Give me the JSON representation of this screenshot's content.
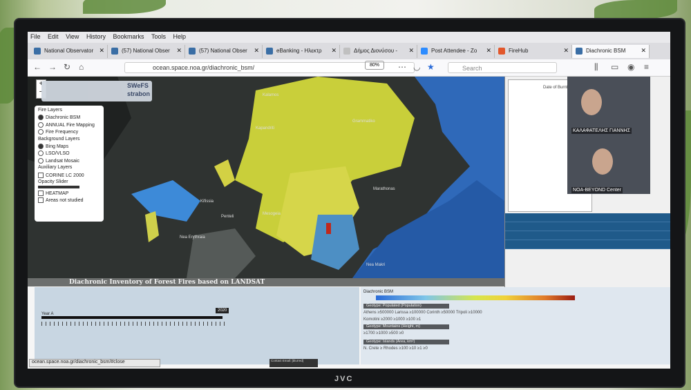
{
  "browser": {
    "menu": [
      "File",
      "Edit",
      "View",
      "History",
      "Bookmarks",
      "Tools",
      "Help"
    ],
    "tabs": [
      {
        "label": "National Observator"
      },
      {
        "label": "(57) National Obser"
      },
      {
        "label": "(57) National Obser"
      },
      {
        "label": "eBanking - Ηλεκτρ"
      },
      {
        "label": "Δήμος Διονύσου -"
      },
      {
        "label": "Post Attendee - Zo"
      },
      {
        "label": "FireHub"
      },
      {
        "label": "Diachronic BSM"
      }
    ],
    "url": "ocean.space.noa.gr/diachronic_bsm/",
    "zoom": "80%",
    "search_placeholder": "Search"
  },
  "map": {
    "logos": [
      "SWeFS",
      "strabon"
    ],
    "layers_panel": {
      "fire_header": "Fire Layers",
      "fire_items": [
        "Diachronic BSM",
        "ANNUAL Fire Mapping",
        "Fire Frequency"
      ],
      "background_header": "Background Layers",
      "background_items": [
        "Bing Maps",
        "LSO/VLSO",
        "Landsat Mosaic"
      ],
      "aux_header": "Auxiliary Layers",
      "aux_items": [
        "CORINE LC 2000",
        "Opacity Slider",
        "HEATMAP",
        "Areas not studied"
      ]
    },
    "places": [
      "Kalamos",
      "Grammatiko",
      "Marathonas",
      "Kapandriti",
      "Nea Makri",
      "Kifissia",
      "Penteli",
      "Mesogeia",
      "Nea Erythraia"
    ]
  },
  "panel": {
    "legend_title": "Date of Burnt Ar",
    "video": {
      "name_1": "ΚΑΛΑΦΑΤΕΛΗΣ ΓΙΑΝΝΗΣ",
      "name_2": "NOA-BEYOND Center"
    }
  },
  "bottom": {
    "title": "Diachronic Inventory of Forest Fires based on LANDSAT",
    "year_label": "Year A",
    "year_value": "2020",
    "bsm_title": "Diachronic BSM",
    "categories": [
      {
        "name": "Geotype: Populated (Population)"
      },
      {
        "name": "Geotype: Mountains (Height, m)"
      },
      {
        "name": "Geotype: Islands (Area, km²)"
      }
    ],
    "rows": [
      "Athens  ≥500000   Larissa  ≥100000   Corinth  ≥50000   Tripoli  ≥10000",
      "Komotini  ≥2000   ≥1000   ≥100   ≥1",
      "≥1700   ≥1000   ≥500   ≥0",
      "N. Crete  ≥ Rhodes   ≥100   ≥10   ≥1   ≥0"
    ],
    "status_url": "ocean.space.noa.gr/diachronic_bsm/#close",
    "contact": "Contact Email: [blurred]"
  },
  "device": {
    "brand": "JVC"
  }
}
